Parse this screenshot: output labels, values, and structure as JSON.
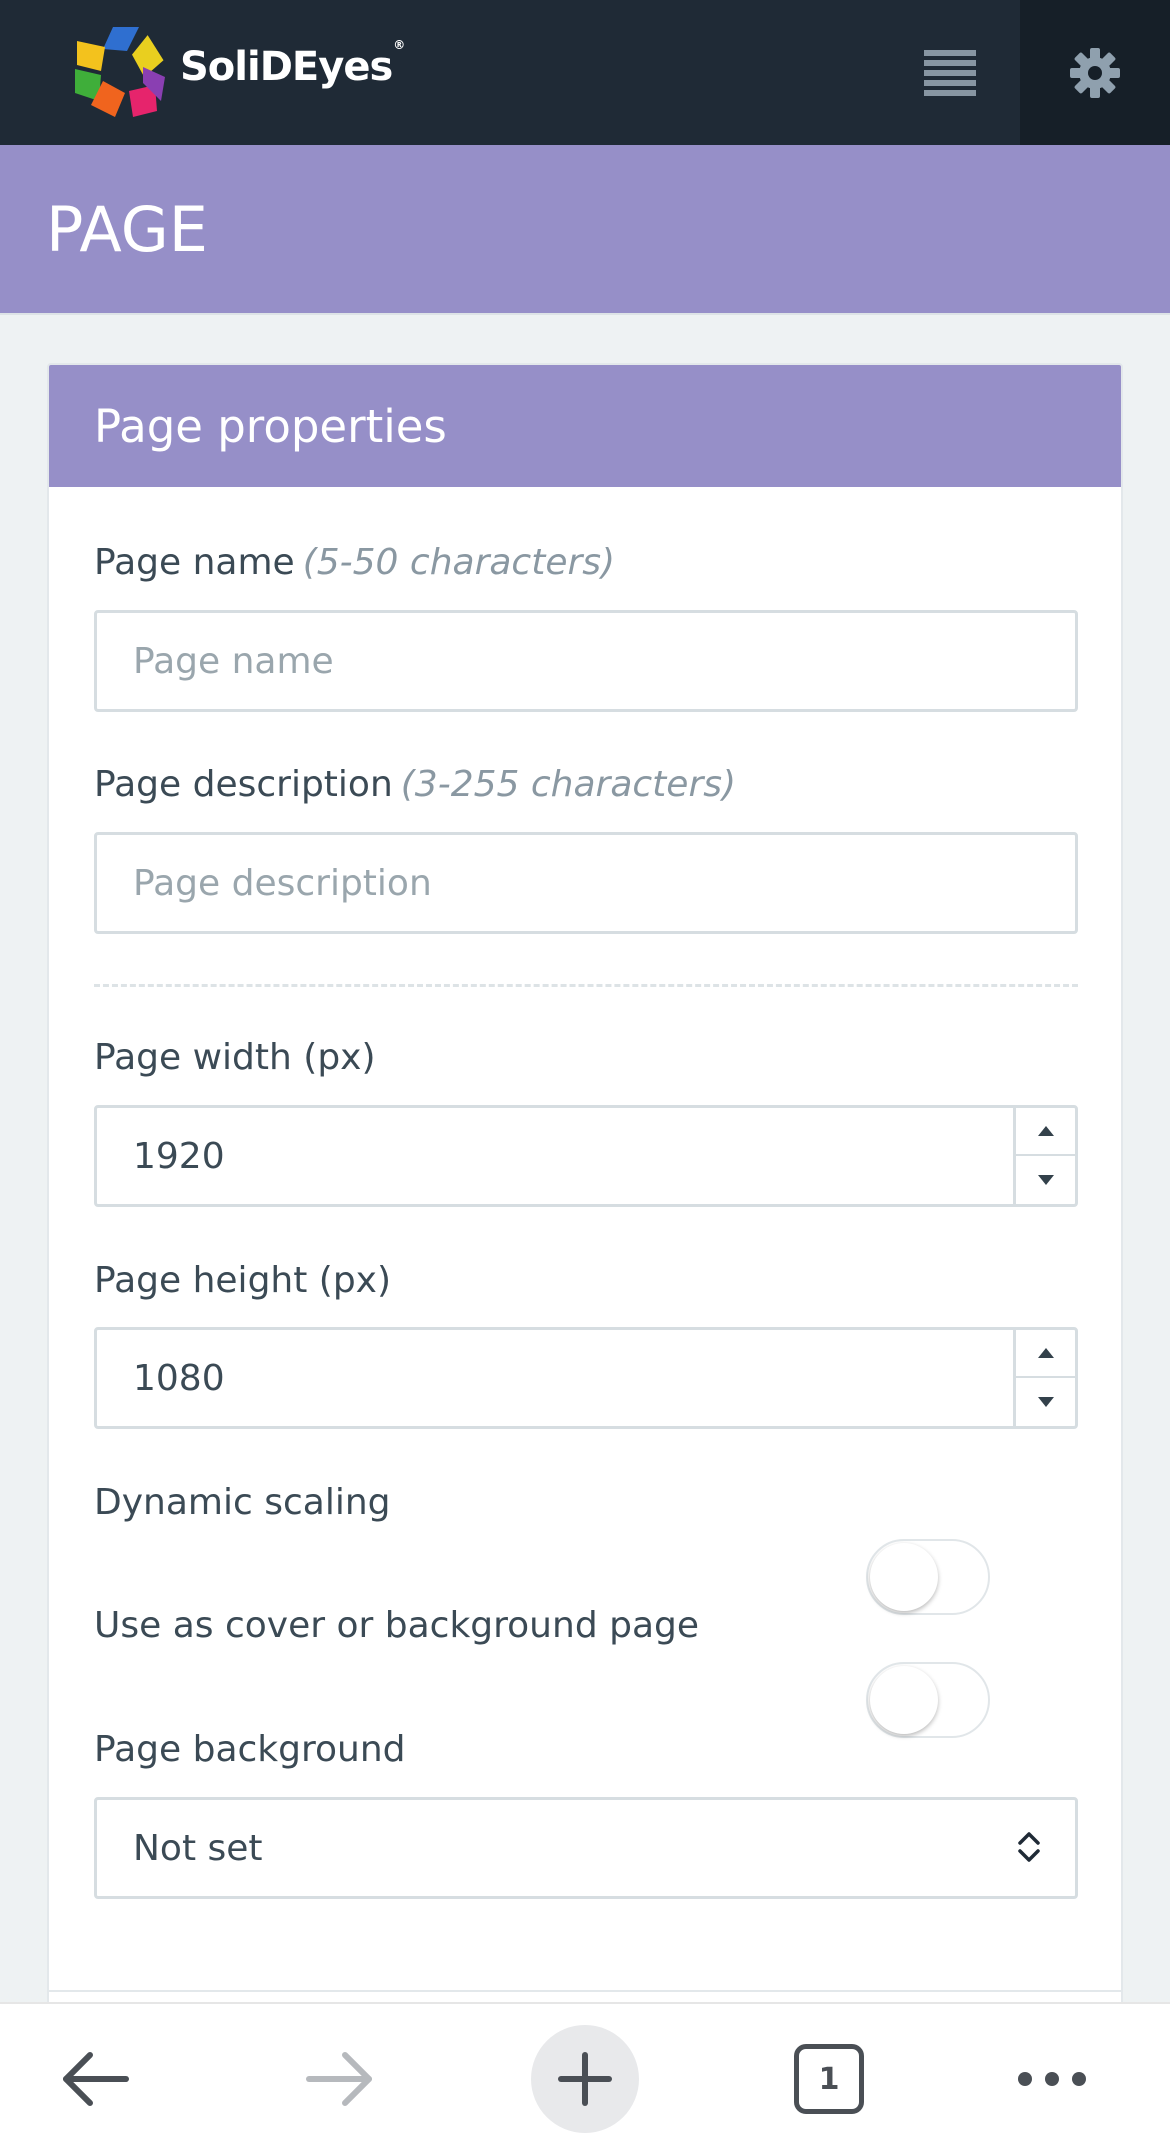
{
  "brand": {
    "name": "SoliDEyes",
    "registered": "®"
  },
  "header": {
    "page_title": "PAGE"
  },
  "panel": {
    "title": "Page properties",
    "fields": {
      "page_name": {
        "label": "Page name",
        "hint": "(5-50 characters)",
        "placeholder": "Page name",
        "value": ""
      },
      "page_description": {
        "label": "Page description",
        "hint": "(3-255 characters)",
        "placeholder": "Page description",
        "value": ""
      },
      "page_width": {
        "label": "Page width (px)",
        "value": "1920"
      },
      "page_height": {
        "label": "Page height (px)",
        "value": "1080"
      },
      "dynamic_scaling": {
        "label": "Dynamic scaling",
        "enabled": false
      },
      "cover_page": {
        "label": "Use as cover or background page",
        "enabled": false
      },
      "page_background": {
        "label": "Page background",
        "selected": "Not set"
      }
    }
  },
  "browser": {
    "tab_count": "1"
  },
  "colors": {
    "navbar": "#1f2a36",
    "accent": "#968fc8",
    "background": "#eef2f3"
  },
  "icons": {
    "menu": "list-icon",
    "settings": "gear-icon",
    "back": "arrow-left-icon",
    "forward": "arrow-right-icon",
    "new_tab": "plus-icon",
    "tabs": "tabs-icon",
    "more": "more-dots-icon"
  }
}
